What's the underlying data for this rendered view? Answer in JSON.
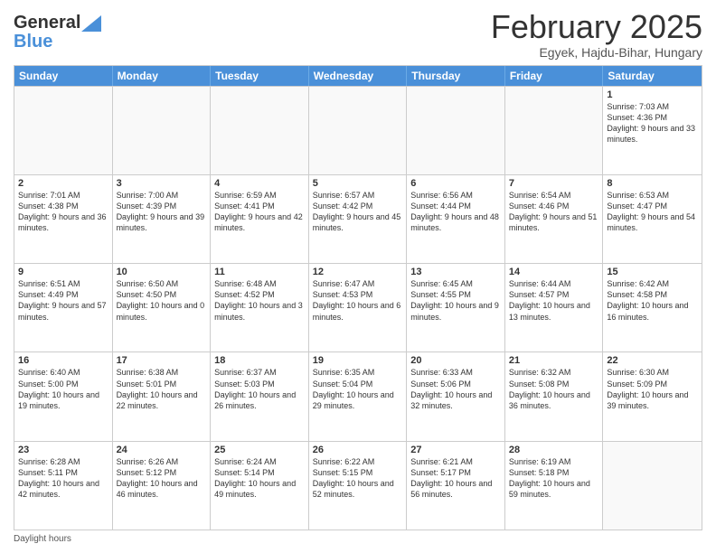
{
  "logo": {
    "general": "General",
    "blue": "Blue"
  },
  "title": "February 2025",
  "location": "Egyek, Hajdu-Bihar, Hungary",
  "days_of_week": [
    "Sunday",
    "Monday",
    "Tuesday",
    "Wednesday",
    "Thursday",
    "Friday",
    "Saturday"
  ],
  "footer_label": "Daylight hours",
  "weeks": [
    [
      {
        "day": "",
        "info": ""
      },
      {
        "day": "",
        "info": ""
      },
      {
        "day": "",
        "info": ""
      },
      {
        "day": "",
        "info": ""
      },
      {
        "day": "",
        "info": ""
      },
      {
        "day": "",
        "info": ""
      },
      {
        "day": "1",
        "info": "Sunrise: 7:03 AM\nSunset: 4:36 PM\nDaylight: 9 hours and 33 minutes."
      }
    ],
    [
      {
        "day": "2",
        "info": "Sunrise: 7:01 AM\nSunset: 4:38 PM\nDaylight: 9 hours and 36 minutes."
      },
      {
        "day": "3",
        "info": "Sunrise: 7:00 AM\nSunset: 4:39 PM\nDaylight: 9 hours and 39 minutes."
      },
      {
        "day": "4",
        "info": "Sunrise: 6:59 AM\nSunset: 4:41 PM\nDaylight: 9 hours and 42 minutes."
      },
      {
        "day": "5",
        "info": "Sunrise: 6:57 AM\nSunset: 4:42 PM\nDaylight: 9 hours and 45 minutes."
      },
      {
        "day": "6",
        "info": "Sunrise: 6:56 AM\nSunset: 4:44 PM\nDaylight: 9 hours and 48 minutes."
      },
      {
        "day": "7",
        "info": "Sunrise: 6:54 AM\nSunset: 4:46 PM\nDaylight: 9 hours and 51 minutes."
      },
      {
        "day": "8",
        "info": "Sunrise: 6:53 AM\nSunset: 4:47 PM\nDaylight: 9 hours and 54 minutes."
      }
    ],
    [
      {
        "day": "9",
        "info": "Sunrise: 6:51 AM\nSunset: 4:49 PM\nDaylight: 9 hours and 57 minutes."
      },
      {
        "day": "10",
        "info": "Sunrise: 6:50 AM\nSunset: 4:50 PM\nDaylight: 10 hours and 0 minutes."
      },
      {
        "day": "11",
        "info": "Sunrise: 6:48 AM\nSunset: 4:52 PM\nDaylight: 10 hours and 3 minutes."
      },
      {
        "day": "12",
        "info": "Sunrise: 6:47 AM\nSunset: 4:53 PM\nDaylight: 10 hours and 6 minutes."
      },
      {
        "day": "13",
        "info": "Sunrise: 6:45 AM\nSunset: 4:55 PM\nDaylight: 10 hours and 9 minutes."
      },
      {
        "day": "14",
        "info": "Sunrise: 6:44 AM\nSunset: 4:57 PM\nDaylight: 10 hours and 13 minutes."
      },
      {
        "day": "15",
        "info": "Sunrise: 6:42 AM\nSunset: 4:58 PM\nDaylight: 10 hours and 16 minutes."
      }
    ],
    [
      {
        "day": "16",
        "info": "Sunrise: 6:40 AM\nSunset: 5:00 PM\nDaylight: 10 hours and 19 minutes."
      },
      {
        "day": "17",
        "info": "Sunrise: 6:38 AM\nSunset: 5:01 PM\nDaylight: 10 hours and 22 minutes."
      },
      {
        "day": "18",
        "info": "Sunrise: 6:37 AM\nSunset: 5:03 PM\nDaylight: 10 hours and 26 minutes."
      },
      {
        "day": "19",
        "info": "Sunrise: 6:35 AM\nSunset: 5:04 PM\nDaylight: 10 hours and 29 minutes."
      },
      {
        "day": "20",
        "info": "Sunrise: 6:33 AM\nSunset: 5:06 PM\nDaylight: 10 hours and 32 minutes."
      },
      {
        "day": "21",
        "info": "Sunrise: 6:32 AM\nSunset: 5:08 PM\nDaylight: 10 hours and 36 minutes."
      },
      {
        "day": "22",
        "info": "Sunrise: 6:30 AM\nSunset: 5:09 PM\nDaylight: 10 hours and 39 minutes."
      }
    ],
    [
      {
        "day": "23",
        "info": "Sunrise: 6:28 AM\nSunset: 5:11 PM\nDaylight: 10 hours and 42 minutes."
      },
      {
        "day": "24",
        "info": "Sunrise: 6:26 AM\nSunset: 5:12 PM\nDaylight: 10 hours and 46 minutes."
      },
      {
        "day": "25",
        "info": "Sunrise: 6:24 AM\nSunset: 5:14 PM\nDaylight: 10 hours and 49 minutes."
      },
      {
        "day": "26",
        "info": "Sunrise: 6:22 AM\nSunset: 5:15 PM\nDaylight: 10 hours and 52 minutes."
      },
      {
        "day": "27",
        "info": "Sunrise: 6:21 AM\nSunset: 5:17 PM\nDaylight: 10 hours and 56 minutes."
      },
      {
        "day": "28",
        "info": "Sunrise: 6:19 AM\nSunset: 5:18 PM\nDaylight: 10 hours and 59 minutes."
      },
      {
        "day": "",
        "info": ""
      }
    ]
  ]
}
